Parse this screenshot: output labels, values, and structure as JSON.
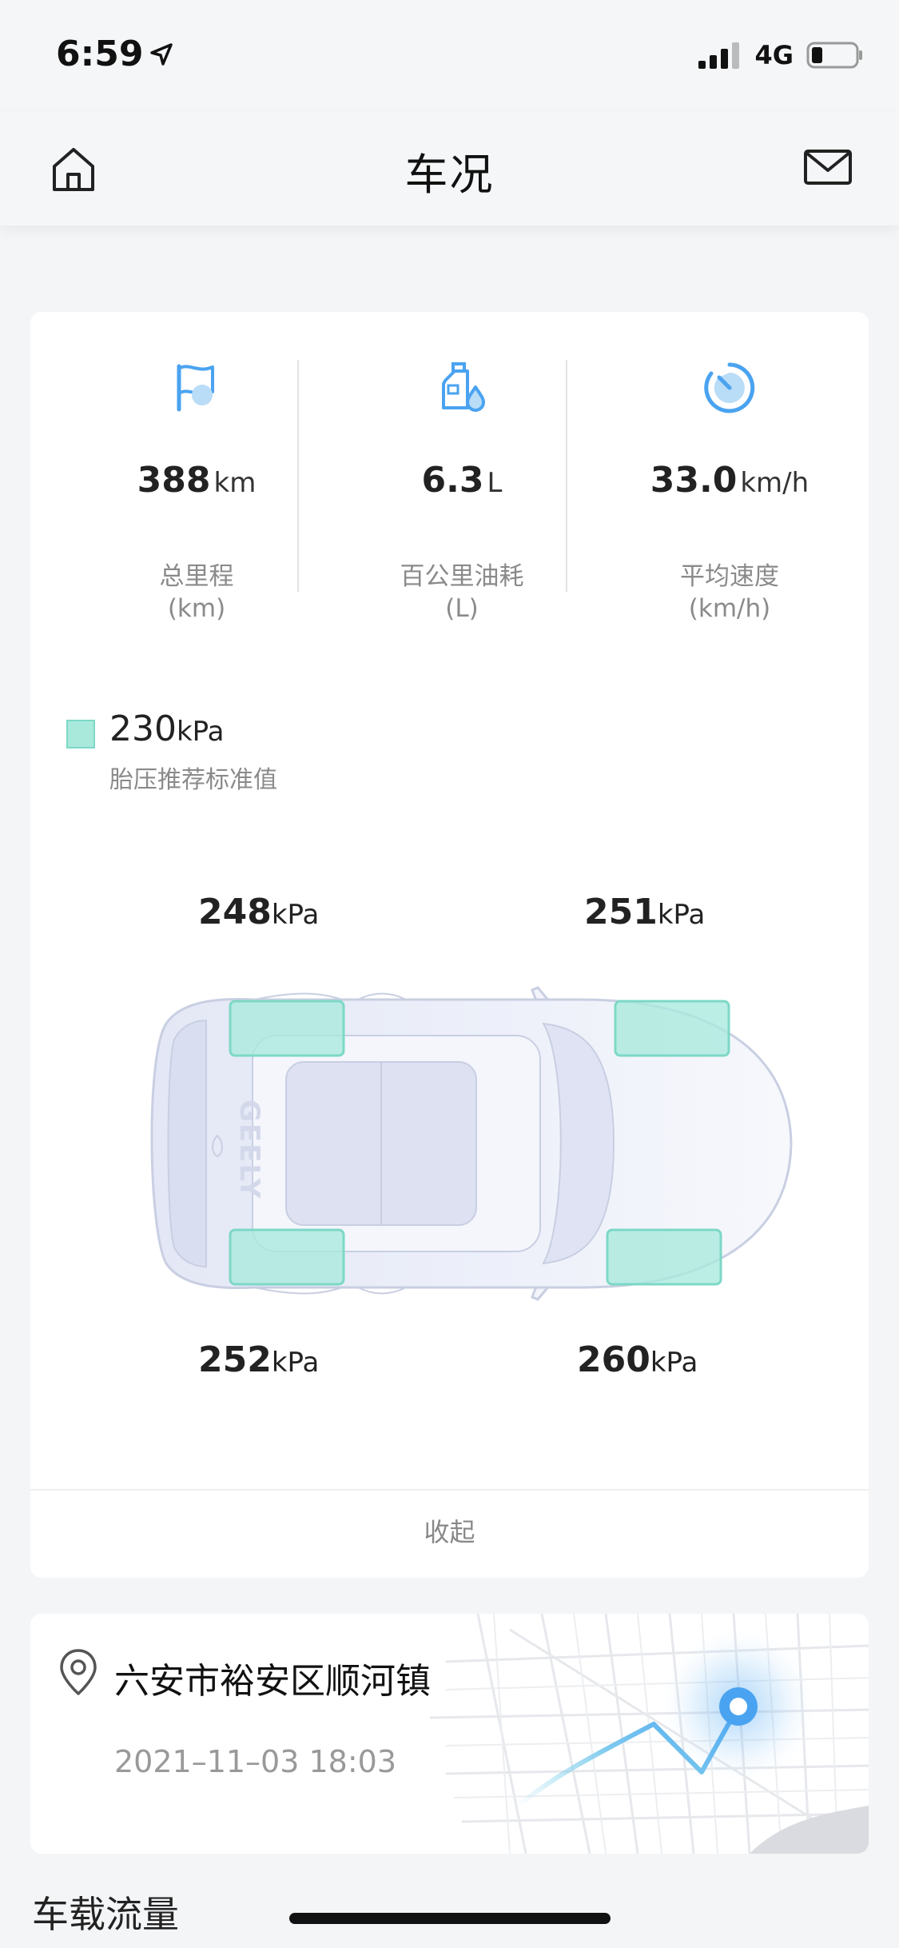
{
  "status_bar": {
    "time": "6:59",
    "network": "4G"
  },
  "nav": {
    "title": "车况"
  },
  "stats": [
    {
      "icon": "flag-icon",
      "value": "388",
      "unit": "km",
      "label": "总里程",
      "sub": "(km)"
    },
    {
      "icon": "fuel-icon",
      "value": "6.3",
      "unit": "L",
      "label": "百公里油耗",
      "sub": "(L)"
    },
    {
      "icon": "speedometer-icon",
      "value": "33.0",
      "unit": "km/h",
      "label": "平均速度",
      "sub": "(km/h)"
    }
  ],
  "tire": {
    "standard_value": "230",
    "standard_unit": "kPa",
    "standard_label": "胎压推荐标准值",
    "swatch_color": "#a8e9dc",
    "front_left": {
      "value": "248",
      "unit": "kPa"
    },
    "front_right": {
      "value": "251",
      "unit": "kPa"
    },
    "rear_left": {
      "value": "252",
      "unit": "kPa"
    },
    "rear_right": {
      "value": "260",
      "unit": "kPa"
    },
    "car_brand": "GEELY"
  },
  "collapse_label": "收起",
  "location": {
    "address": "六安市裕安区顺河镇",
    "time": "2021–11–03 18:03"
  },
  "next_section_title": "车载流量",
  "colors": {
    "accent_blue": "#4aa3f0",
    "tire_green": "#a8e9dc"
  }
}
